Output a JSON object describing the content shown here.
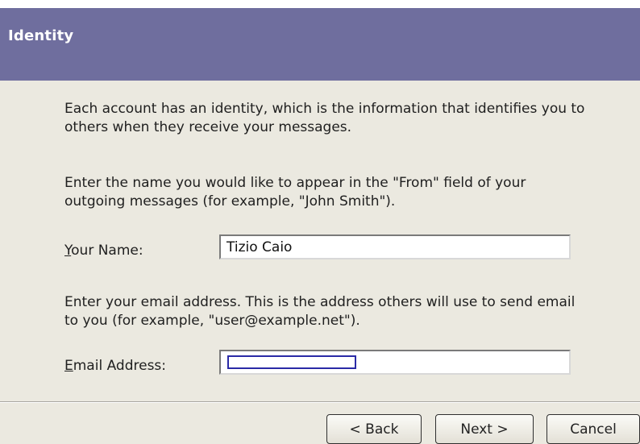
{
  "dialog": {
    "title": "Identity",
    "intro_text": "Each account has an identity, which is the information that identifies you to others when they receive your messages.",
    "name_instruction": "Enter the name you would like to appear in the \"From\" field of your outgoing messages (for example, \"John Smith\").",
    "email_instruction": "Enter your email address. This is the address others will use to send email to you (for example, \"user@example.net\")."
  },
  "fields": {
    "name_label_mnemonic": "Y",
    "name_label_rest": "our Name:",
    "name_value": "Tizio Caio",
    "email_label_mnemonic": "E",
    "email_label_rest": "mail Address:",
    "email_value": ""
  },
  "buttons": {
    "back": "< Back",
    "next": "Next >",
    "cancel": "Cancel"
  },
  "colors": {
    "header_bg": "#6f6e9e",
    "dialog_bg": "#ebe9e0",
    "focus_border": "#2a2aa6"
  }
}
